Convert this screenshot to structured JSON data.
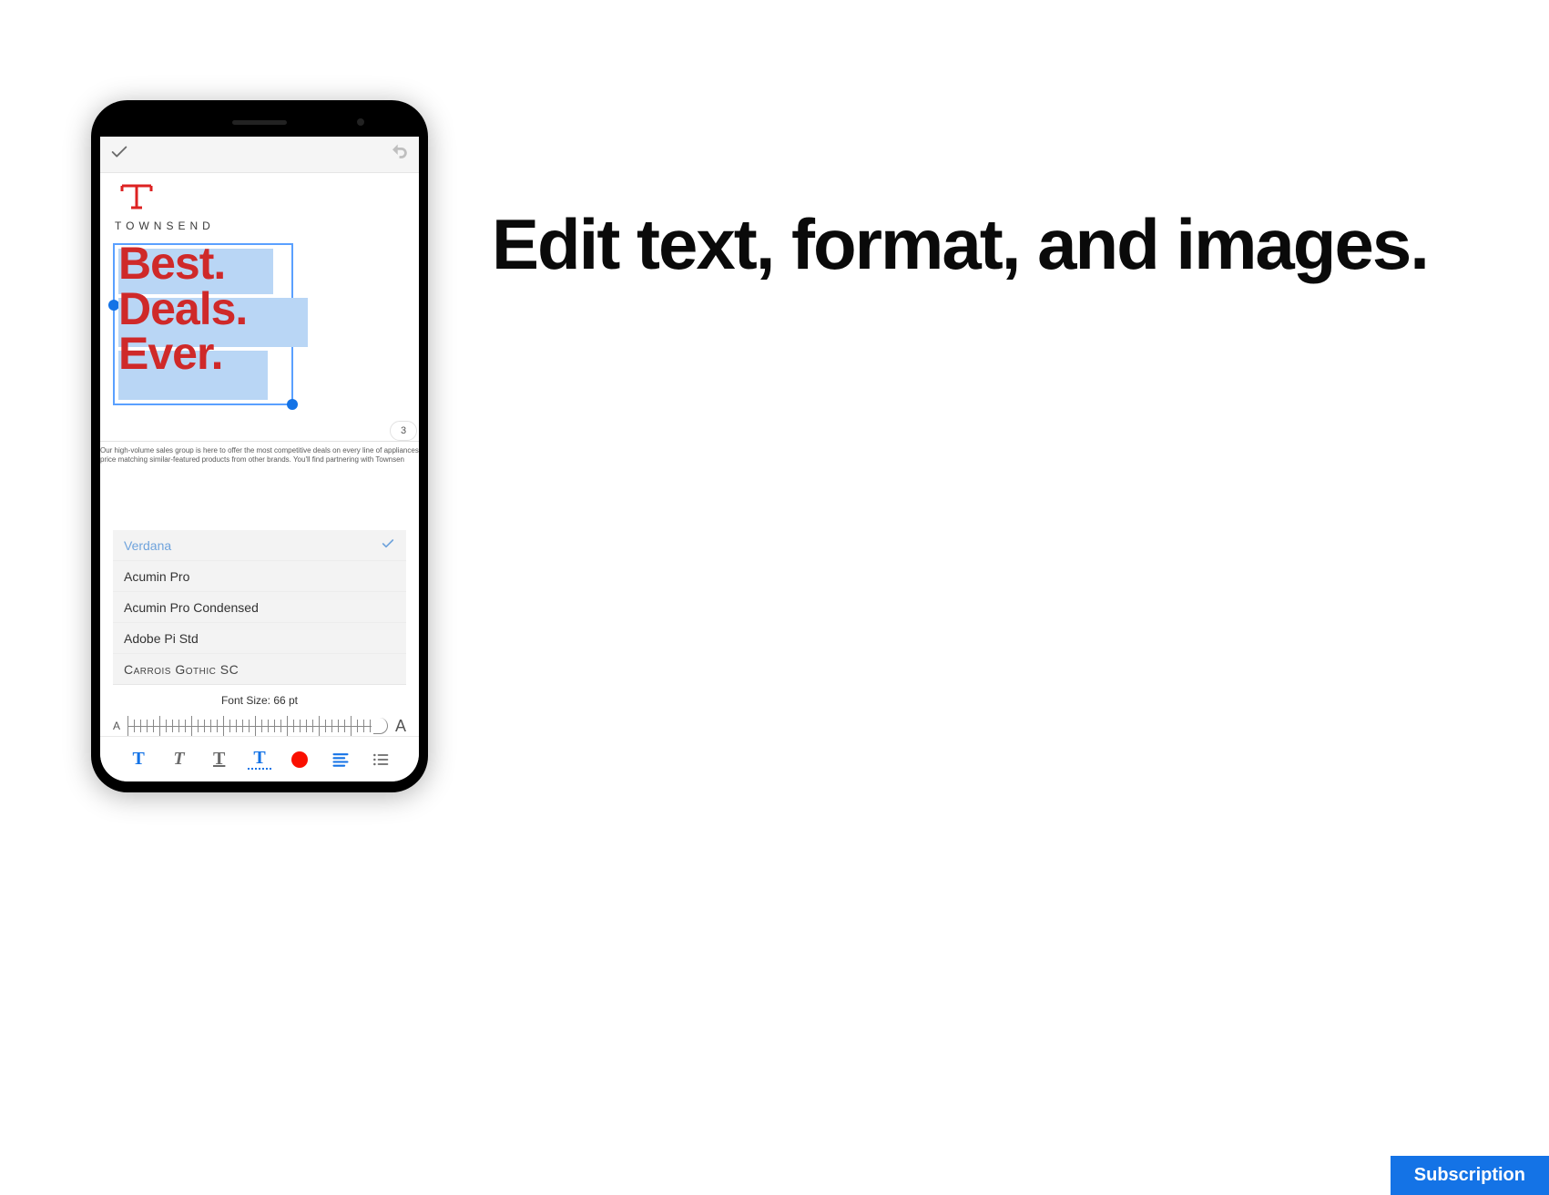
{
  "promo_headline": "Edit text, format, and images.",
  "subscription_label": "Subscription",
  "phone": {
    "brand_name": "TOWNSEND",
    "headline": {
      "line1": "Best.",
      "line2": "Deals.",
      "line3": "Ever."
    },
    "page_number": "3",
    "body_text": "Our high-volume sales group is here to offer the most competitive deals on every line of appliances price matching similar-featured products from other brands. You'll find partnering with Townsen",
    "fonts": [
      {
        "name": "Verdana",
        "selected": true
      },
      {
        "name": "Acumin Pro",
        "selected": false
      },
      {
        "name": "Acumin Pro Condensed",
        "selected": false
      },
      {
        "name": "Adobe Pi Std",
        "selected": false
      },
      {
        "name": "Carrois Gothic SC",
        "selected": false
      }
    ],
    "font_size_label": "Font Size: 66 pt",
    "toolbar_icons": [
      "bold",
      "italic",
      "underline",
      "text-color",
      "fill-color",
      "align",
      "list"
    ]
  }
}
